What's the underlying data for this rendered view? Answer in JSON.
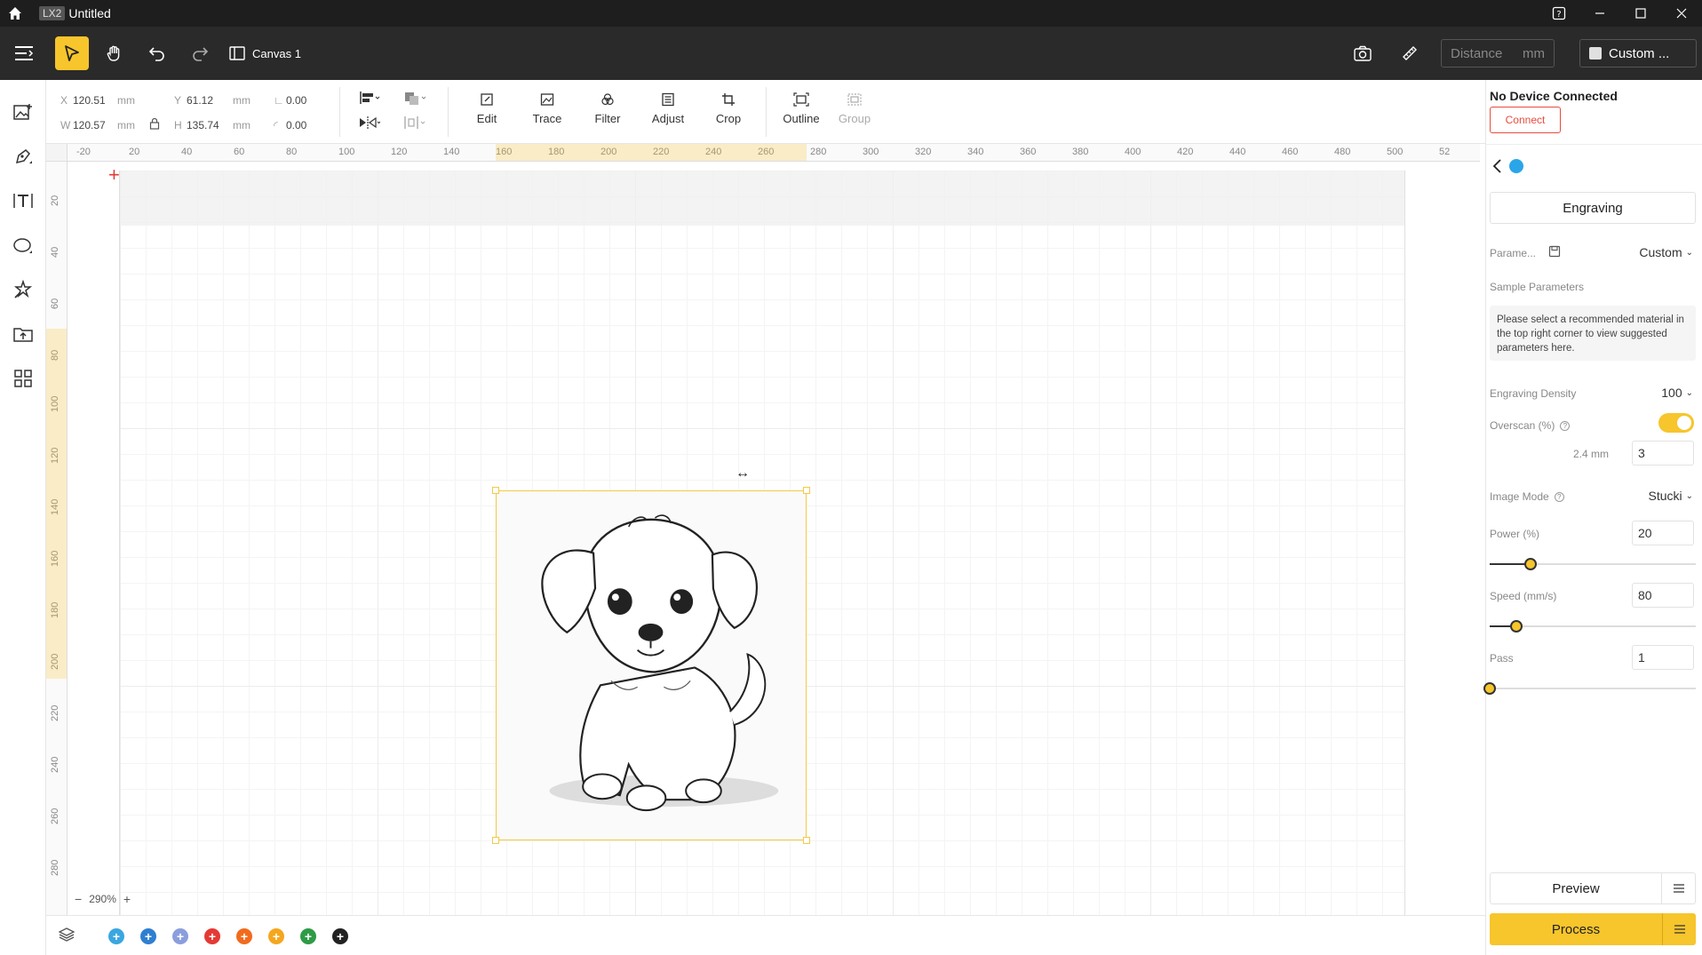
{
  "app": {
    "badge": "LX2",
    "title": "Untitled"
  },
  "toolbar": {
    "canvas_tab": "Canvas 1",
    "distance_placeholder": "Distance",
    "distance_unit": "mm",
    "device_label": "Custom ..."
  },
  "props": {
    "x_label": "X",
    "x_value": "120.51",
    "x_unit": "mm",
    "y_label": "Y",
    "y_value": "61.12",
    "y_unit": "mm",
    "w_label": "W",
    "w_value": "120.57",
    "w_unit": "mm",
    "h_label": "H",
    "h_value": "135.74",
    "h_unit": "mm",
    "angle_value": "0.00",
    "corner_value": "0.00"
  },
  "tools": [
    {
      "label": "Edit",
      "enabled": true
    },
    {
      "label": "Trace",
      "enabled": true
    },
    {
      "label": "Filter",
      "enabled": true
    },
    {
      "label": "Adjust",
      "enabled": true
    },
    {
      "label": "Crop",
      "enabled": true
    },
    {
      "label": "Outline",
      "enabled": true
    },
    {
      "label": "Group",
      "enabled": false
    }
  ],
  "ruler_top": [
    "-20",
    "20",
    "40",
    "60",
    "80",
    "100",
    "120",
    "140",
    "160",
    "180",
    "200",
    "220",
    "240",
    "260",
    "280",
    "300",
    "320",
    "340",
    "360",
    "380",
    "400",
    "420",
    "440",
    "460",
    "480",
    "500",
    "52"
  ],
  "ruler_left": [
    "20",
    "40",
    "60",
    "80",
    "100",
    "120",
    "140",
    "160",
    "180",
    "200",
    "220",
    "240",
    "260",
    "280"
  ],
  "zoom": "290%",
  "layers": [
    {
      "color": "#3aa7e0"
    },
    {
      "color": "#2f7fd1"
    },
    {
      "color": "#8a9ede"
    },
    {
      "color": "#e53935"
    },
    {
      "color": "#f26b1d"
    },
    {
      "color": "#f4a71d"
    },
    {
      "color": "#2e9b46"
    },
    {
      "color": "#222222"
    }
  ],
  "right": {
    "device_status": "No Device Connected",
    "connect_label": "Connect",
    "mode_label": "Engraving",
    "params_label": "Parame...",
    "params_value": "Custom",
    "sample_label": "Sample Parameters",
    "hint": "Please select a recommended material in the top right corner to view suggested parameters here.",
    "density_label": "Engraving Density",
    "density_value": "100",
    "overscan_label": "Overscan  (%)",
    "overscan_mm": "2.4 mm",
    "overscan_value": "3",
    "overscan_on": true,
    "image_mode_label": "Image Mode",
    "image_mode_value": "Stucki",
    "power_label": "Power  (%)",
    "power_value": "20",
    "power_fraction": 0.2,
    "speed_label": "Speed  (mm/s)",
    "speed_value": "80",
    "speed_fraction": 0.13,
    "pass_label": "Pass",
    "pass_value": "1",
    "pass_fraction": 0.0,
    "preview_label": "Preview",
    "process_label": "Process"
  },
  "colors": {
    "accent": "#f7c52c",
    "danger": "#e74c3c",
    "dark": "#2a2a2a"
  }
}
